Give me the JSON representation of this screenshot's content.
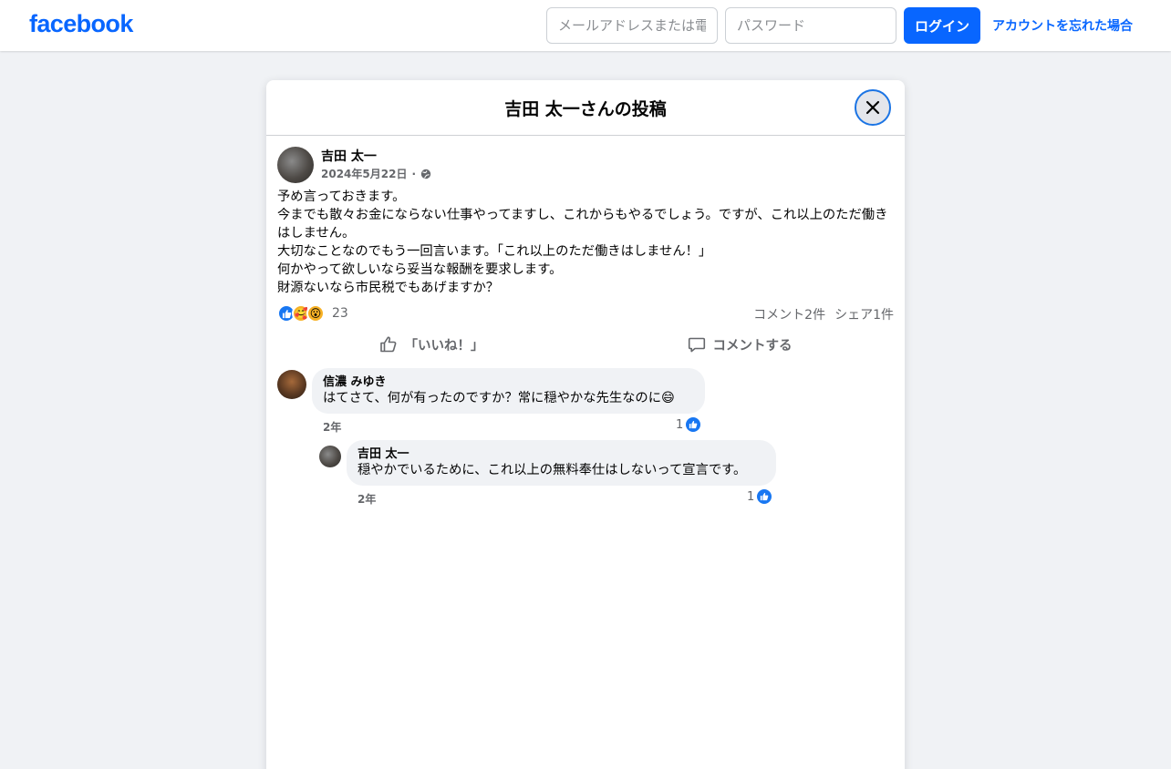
{
  "topbar": {
    "logo": "facebook",
    "email_placeholder": "メールアドレスまたは電話番号",
    "password_placeholder": "パスワード",
    "login_label": "ログイン",
    "forgot_label": "アカウントを忘れた場合"
  },
  "dialog": {
    "title": "吉田 太一さんの投稿"
  },
  "post": {
    "author": "吉田 太一",
    "date": "2024年5月22日",
    "separator": "·",
    "privacy_icon": "globe-icon",
    "lines": [
      "予め言っておきます。",
      "今までも散々お金にならない仕事やってますし、これからもやるでしょう。ですが、これ以上のただ働きはしません。",
      "大切なことなのでもう一回言います。「これ以上のただ働きはしません！」",
      "何かやって欲しいなら妥当な報酬を要求します。",
      "財源ないなら市民税でもあげますか？"
    ],
    "reaction_icons": [
      "like-icon",
      "care-icon",
      "wow-icon"
    ],
    "reaction_count": "23",
    "comments_count": "コメント2件",
    "shares_count": "シェア1件",
    "like_action": "「いいね！」",
    "comment_action": "コメントする"
  },
  "comments": [
    {
      "author": "信濃 みゆき",
      "text": "はてさて、何が有ったのですか？常に穏やかな先生なのに😄",
      "time": "2年",
      "likes": "1"
    },
    {
      "author": "吉田 太一",
      "text": "穏やかでいるために、これ以上の無料奉仕はしないって宣言です。",
      "time": "2年",
      "likes": "1"
    }
  ],
  "colors": {
    "brand": "#0866ff",
    "background": "#f0f2f5",
    "secondary_text": "#65676b"
  }
}
